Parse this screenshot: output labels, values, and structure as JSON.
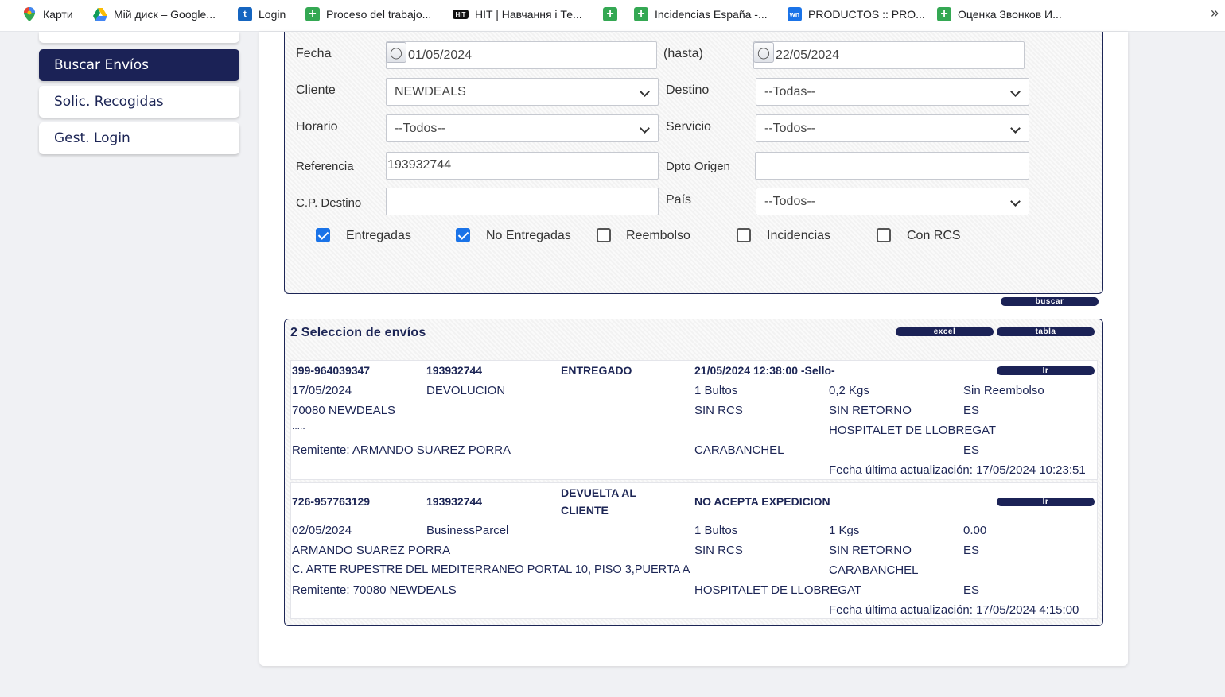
{
  "bookmarks": [
    {
      "label": "Карти",
      "icon": "maps-pin-icon"
    },
    {
      "label": "Мій диск – Google...",
      "icon": "google-drive-icon"
    },
    {
      "label": "Login",
      "icon": "login-app-icon"
    },
    {
      "label": "Proceso del trabajo...",
      "icon": "sheets-plus-icon"
    },
    {
      "label": "HIT | Навчання і Те...",
      "icon": "hit-logo-icon"
    },
    {
      "label": "",
      "icon": "sheets-plus-icon"
    },
    {
      "label": "Incidencias España -...",
      "icon": "sheets-plus-icon"
    },
    {
      "label": "PRODUCTOS :: PRO...",
      "icon": "wn-logo-icon"
    },
    {
      "label": "Оценка Звонков И...",
      "icon": "sheets-plus-icon"
    }
  ],
  "sidebar": {
    "items": [
      {
        "label": "Buscar Envíos",
        "active": true
      },
      {
        "label": "Solic. Recogidas",
        "active": false
      },
      {
        "label": "Gest. Login",
        "active": false
      }
    ]
  },
  "filters": {
    "fecha_label": "Fecha",
    "fecha_from": "01/05/2024",
    "hasta_label": "(hasta)",
    "fecha_to": "22/05/2024",
    "cliente_label": "Cliente",
    "cliente_value": "NEWDEALS",
    "destino_label": "Destino",
    "destino_value": "--Todas--",
    "horario_label": "Horario",
    "horario_value": "--Todos--",
    "servicio_label": "Servicio",
    "servicio_value": "--Todos--",
    "referencia_label": "Referencia",
    "referencia_value": "193932744",
    "dpto_label": "Dpto Origen",
    "dpto_value": "",
    "cp_label": "C.P. Destino",
    "cp_value": "",
    "pais_label": "País",
    "pais_value": "--Todos--",
    "checkboxes": [
      {
        "label": "Entregadas",
        "checked": true
      },
      {
        "label": "No Entregadas",
        "checked": true
      },
      {
        "label": "Reembolso",
        "checked": false
      },
      {
        "label": "Incidencias",
        "checked": false
      },
      {
        "label": "Con RCS",
        "checked": false
      }
    ],
    "buscar_label": "buscar"
  },
  "results": {
    "title": "2 Seleccion de envíos",
    "excel_label": "excel",
    "tabla_label": "tabla",
    "ir_label": "Ir",
    "shipments": [
      {
        "expedicion": "399-964039347",
        "referencia": "193932744",
        "estado": "ENTREGADO",
        "detalle": "21/05/2024 12:38:00 -Sello-",
        "fecha": "17/05/2024",
        "servicio": "DEVOLUCION",
        "bultos": "1 Bultos",
        "kgs": "0,2 Kgs",
        "reembolso": "Sin Reembolso",
        "destinatario": "70080 NEWDEALS",
        "rcs": "SIN RCS",
        "retorno": "SIN RETORNO",
        "pais_dest": "ES",
        "direccion": ".....",
        "poblacion_dest": "HOSPITALET DE LLOBREGAT",
        "remitente": "Remitente: ARMANDO SUAREZ PORRA",
        "poblacion_rem": "CARABANCHEL",
        "pais_rem": "ES",
        "actualizacion": "Fecha última actualización: 17/05/2024 10:23:51"
      },
      {
        "expedicion": "726-957763129",
        "referencia": "193932744",
        "estado_l1": "DEVUELTA AL",
        "estado_l2": "CLIENTE",
        "detalle": "NO ACEPTA EXPEDICION",
        "fecha": "02/05/2024",
        "servicio": "BusinessParcel",
        "bultos": "1 Bultos",
        "kgs": "1 Kgs",
        "reembolso": "0.00",
        "destinatario": "ARMANDO SUAREZ PORRA",
        "rcs": "SIN RCS",
        "retorno": "SIN RETORNO",
        "pais_dest": "ES",
        "direccion": "C. ARTE RUPESTRE DEL MEDITERRANEO PORTAL 10, PISO 3,PUERTA A",
        "poblacion_dest": "CARABANCHEL",
        "remitente": "Remitente: 70080 NEWDEALS",
        "poblacion_rem": "HOSPITALET DE LLOBREGAT",
        "pais_rem": "ES",
        "actualizacion": "Fecha última actualización: 17/05/2024 4:15:00"
      }
    ]
  },
  "colors": {
    "navy": "#1b2256",
    "checkbox_blue": "#1a73e8",
    "sheets_green": "#34a853"
  }
}
